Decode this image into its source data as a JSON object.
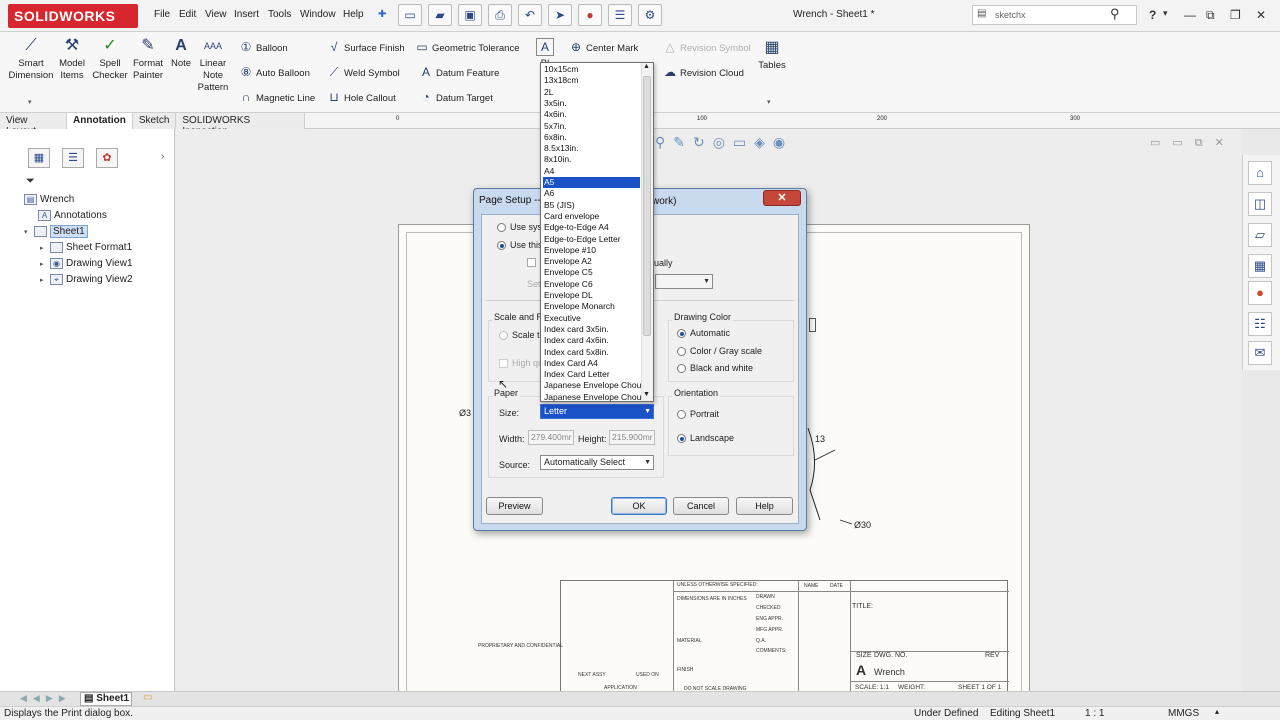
{
  "titlebar": {
    "app_name": "SOLIDWORKS",
    "menus": [
      "File",
      "Edit",
      "View",
      "Insert",
      "Tools",
      "Window",
      "Help"
    ],
    "doc_title": "Wrench - Sheet1 *",
    "search_value": "sketchx",
    "help_label": "?"
  },
  "ribbon": {
    "smart_dimension": "Smart Dimension",
    "model_items": "Model Items",
    "spell_checker": "Spell Checker",
    "format_painter": "Format Painter",
    "note": "Note",
    "linear_note_pattern": "Linear Note Pattern",
    "balloon": "Balloon",
    "auto_balloon": "Auto Balloon",
    "magnetic_line": "Magnetic Line",
    "surface_finish": "Surface Finish",
    "weld_symbol": "Weld Symbol",
    "hole_callout": "Hole Callout",
    "geometric_tolerance": "Geometric Tolerance",
    "datum_feature": "Datum Feature",
    "datum_target": "Datum Target",
    "center_mark": "Center Mark",
    "revision_symbol": "Revision Symbol",
    "revision_cloud": "Revision Cloud",
    "tables": "Tables",
    "partial_bl": "Bl"
  },
  "tabs": [
    "View Layout",
    "Annotation",
    "Sketch",
    "SOLIDWORKS Inspection"
  ],
  "ruler": [
    "0",
    "100",
    "200",
    "300"
  ],
  "tree": {
    "root": "Wrench",
    "annotations": "Annotations",
    "sheet": "Sheet1",
    "sheet_format": "Sheet Format1",
    "view1": "Drawing View1",
    "view2": "Drawing View2"
  },
  "dialog": {
    "title_left": "Page Setup --",
    "title_right": "work)",
    "use_system": "Use syst",
    "use_this": "Use this",
    "settings_partial": "Set",
    "individually_partial": "ually",
    "scale_group": "Scale and Re",
    "scale_to": "Scale to",
    "high_quality": "High qu",
    "drawing_color": "Drawing Color",
    "automatic": "Automatic",
    "color_gray": "Color / Gray scale",
    "black_white": "Black and white",
    "paper": "Paper",
    "size_label": "Size:",
    "size_value": "Letter",
    "orientation": "Orientation",
    "portrait": "Portrait",
    "landscape": "Landscape",
    "width_label": "Width:",
    "width_value": "279.400mr",
    "height_label": "Height:",
    "height_value": "215.900mr",
    "source_label": "Source:",
    "source_value": "Automatically Select",
    "preview": "Preview",
    "ok": "OK",
    "cancel": "Cancel",
    "help": "Help"
  },
  "dropdown": {
    "items": [
      "10x15cm",
      "13x18cm",
      "2L",
      "3x5in.",
      "4x6in.",
      "5x7in.",
      "6x8in.",
      "8.5x13in.",
      "8x10in.",
      "A4",
      "A5",
      "A6",
      "B5 (JIS)",
      "Card envelope",
      "Edge-to-Edge A4",
      "Edge-to-Edge Letter",
      "Envelope #10",
      "Envelope A2",
      "Envelope C5",
      "Envelope C6",
      "Envelope DL",
      "Envelope Monarch",
      "Executive",
      "Index card 3x5in.",
      "Index card 4x6in.",
      "Index card 5x8in.",
      "Index Card A4",
      "Index Card Letter",
      "Japanese Envelope Chou",
      "Japanese Envelope Chou"
    ],
    "selected_index": 10
  },
  "drawing": {
    "dim_30": "Ø30",
    "dim_3": "Ø3",
    "dim_13": "13",
    "tb_unless": "UNLESS OTHERWISE SPECIFIED:",
    "tb_name": "NAME",
    "tb_date": "DATE",
    "tb_dims": "DIMENSIONS ARE IN INCHES",
    "tb_drawn": "DRAWN",
    "tb_checked": "CHECKED",
    "tb_eng": "ENG APPR.",
    "tb_mfg": "MFG APPR.",
    "tb_qa": "Q.A.",
    "tb_comments": "COMMENTS:",
    "tb_title": "TITLE:",
    "tb_size": "SIZE",
    "tb_size_val": "A",
    "tb_dwg": "DWG. NO.",
    "tb_dwg_val": "Wrench",
    "tb_rev": "REV",
    "tb_scale": "SCALE: 1:1",
    "tb_weight": "WEIGHT:",
    "tb_sheet": "SHEET 1 OF 1",
    "tb_proprietary": "PROPRIETARY AND CONFIDENTIAL",
    "tb_next_assy": "NEXT ASSY",
    "tb_used_on": "USED ON",
    "tb_application": "APPLICATION",
    "tb_do_not_scale": "DO NOT SCALE DRAWING",
    "tb_finish": "FINISH",
    "tb_material": "MATERIAL"
  },
  "sheet_tab": "Sheet1",
  "status": {
    "hint": "Displays the Print dialog box.",
    "state": "Under Defined",
    "mode": "Editing Sheet1",
    "scale": "1 : 1",
    "units": "MMGS"
  },
  "colors": {
    "brand_red": "#d7262d",
    "selection_blue": "#1a52c8",
    "dialog_frame": "#c9d9ee",
    "close_red": "#c6463a"
  }
}
